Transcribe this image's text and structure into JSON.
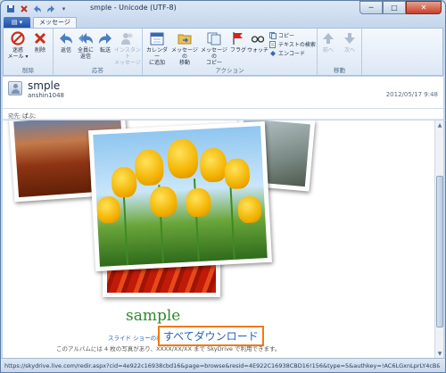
{
  "window": {
    "title": "smple - Unicode (UTF-8)"
  },
  "titlebar_buttons": {
    "minimize": "─",
    "maximize": "□",
    "close": "✕"
  },
  "tabs": {
    "file": "▤ ▾",
    "message": "メッセージ"
  },
  "ribbon": {
    "delete_group": {
      "label": "削除",
      "junk": "迷惑\nメール ▾",
      "delete": "削除"
    },
    "respond_group": {
      "label": "応答",
      "reply": "返信",
      "reply_all": "全員に\n返信",
      "forward": "転送",
      "instant_message": "インスタント\nメッセージ"
    },
    "actions_group": {
      "label": "アクション",
      "add_calendar": "カレンダー\nに追加",
      "move_message": "メッセージの\n移動",
      "copy_message": "メッセージの\nコピー",
      "flag": "フラグ",
      "watch": "ウォッチ",
      "copy": "コピー",
      "find_text": "テキストの検索",
      "encoding": "エンコード"
    },
    "move_group": {
      "label": "移動",
      "previous": "前へ",
      "next": "次へ"
    }
  },
  "message": {
    "subject": "smple",
    "sender": "anshin1048",
    "datetime": "2012/05/17 9:48",
    "to_label": "宛先:",
    "to_value": "ぱぶ;"
  },
  "album": {
    "title": "sample",
    "slideshow_link": "スライド ショーの表示",
    "download_all": "すべてダウンロード",
    "note": "このアルバムには 4 枚の写真があり、XXXX/XX/XX まで SkyDrive で利用できます。"
  },
  "status": {
    "url": "https://skydrive.live.com/redir.aspx?cid=4e922c16938cbd16&page=browse&resid=4E922C16938CBD16!156&type=5&authkey=!AC6LGxnLprLY4cB&v=3"
  },
  "colors": {
    "album_title": "#2d8a2a",
    "link": "#1f5fc0",
    "highlight_border": "#f07a10"
  }
}
